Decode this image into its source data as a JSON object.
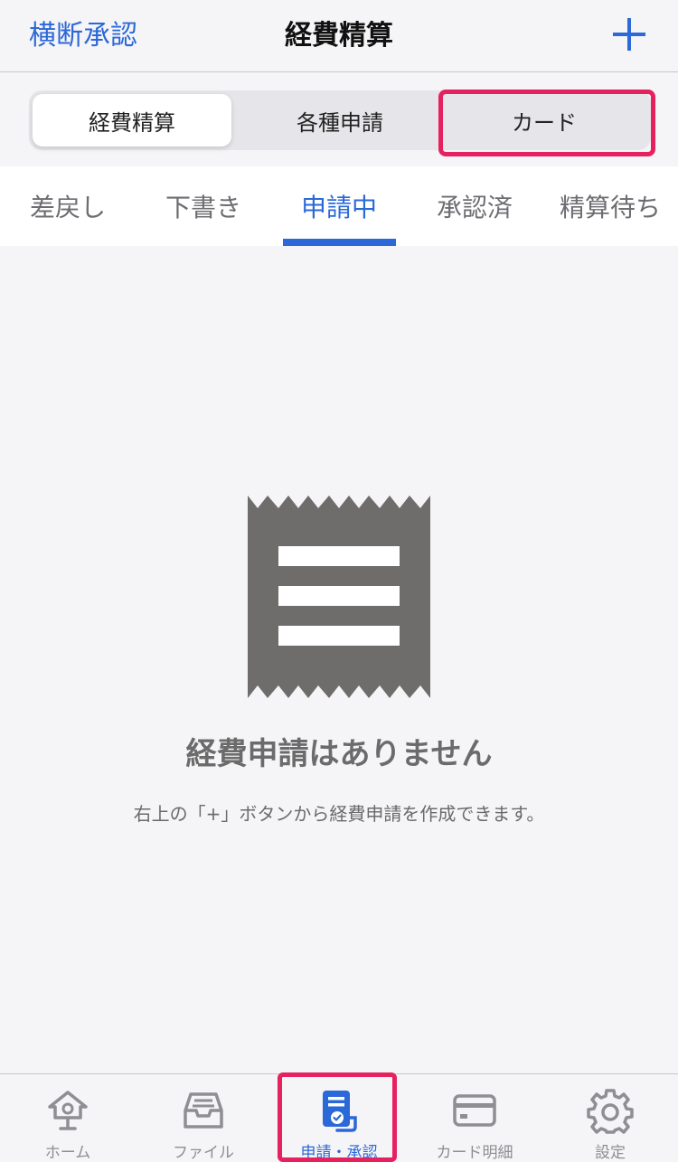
{
  "header": {
    "left_link": "横断承認",
    "title": "経費精算",
    "add_icon": "plus-icon"
  },
  "segments": {
    "items": [
      {
        "label": "経費精算",
        "active": true
      },
      {
        "label": "各種申請",
        "active": false
      },
      {
        "label": "カード",
        "active": false
      }
    ]
  },
  "status_tabs": {
    "items": [
      {
        "label": "差戻し",
        "active": false
      },
      {
        "label": "下書き",
        "active": false
      },
      {
        "label": "申請中",
        "active": true
      },
      {
        "label": "承認済",
        "active": false
      },
      {
        "label": "精算待ち",
        "active": false
      }
    ]
  },
  "empty_state": {
    "icon": "receipt-icon",
    "title": "経費申請はありません",
    "description": "右上の「+」ボタンから経費申請を作成できます。"
  },
  "tabbar": {
    "items": [
      {
        "label": "ホーム",
        "icon": "home-icon",
        "active": false
      },
      {
        "label": "ファイル",
        "icon": "inbox-icon",
        "active": false
      },
      {
        "label": "申請・承認",
        "icon": "application-icon",
        "active": true
      },
      {
        "label": "カード明細",
        "icon": "credit-card-icon",
        "active": false
      },
      {
        "label": "設定",
        "icon": "gear-icon",
        "active": false
      }
    ]
  },
  "colors": {
    "accent": "#2b68d8",
    "highlight": "#e6215f",
    "icon_gray": "#6e6d6b",
    "tab_gray": "#8e8e93"
  }
}
